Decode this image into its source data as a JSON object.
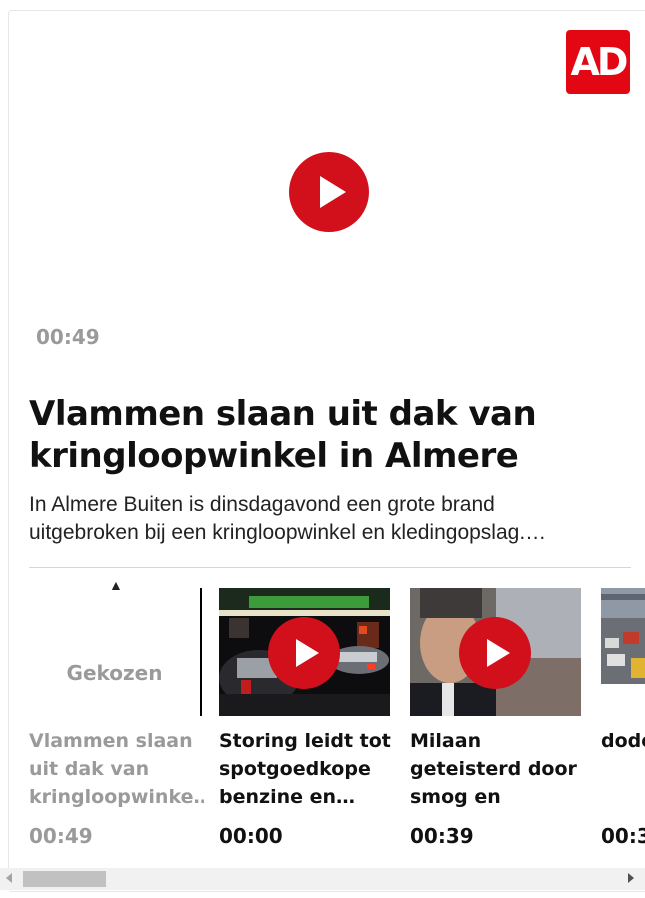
{
  "brand": {
    "logo_text": "AD",
    "accent": "#e30613",
    "play_color": "#d1101c"
  },
  "main": {
    "duration": "00:49",
    "headline_line1": "Vlammen slaan uit dak van",
    "headline_line2": "kringloopwinkel in Almere",
    "intro_line1": "In Almere Buiten is dinsdagavond een grote brand",
    "intro_line2": "uitgebroken bij een kringloopwinkel en kledingopslag.…"
  },
  "rail": {
    "caret": "▲",
    "chosen_label": "Gekozen",
    "items": [
      {
        "title_lines": [
          "Vlammen slaan",
          "uit dak van",
          "kringloopwinke…"
        ],
        "duration": "00:49",
        "chosen": true
      },
      {
        "title_lines": [
          "Storing leidt tot",
          "spotgoedkope",
          "benzine en…"
        ],
        "duration": "00:00"
      },
      {
        "title_lines": [
          "Milaan",
          "geteisterd door",
          "smog en slecht…"
        ],
        "duration": "00:39"
      },
      {
        "title_lines": [
          "",
          "",
          "dode"
        ],
        "duration": "00:3"
      }
    ]
  }
}
